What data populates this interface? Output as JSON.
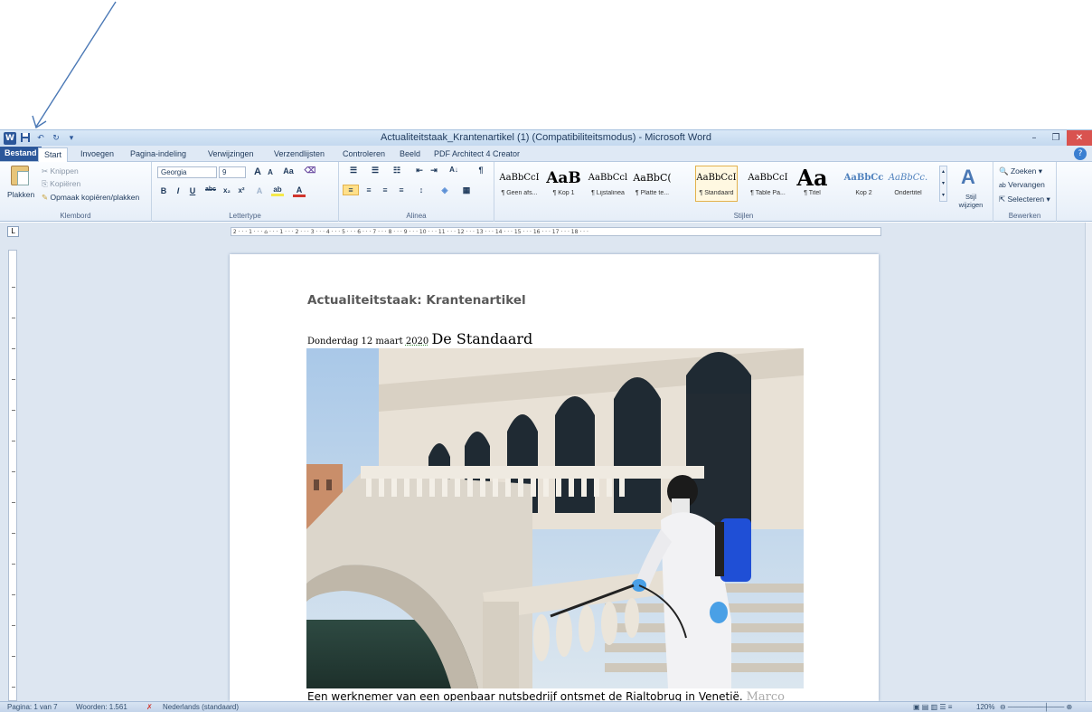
{
  "window": {
    "title": "Actualiteitstaak_Krantenartikel (1) (Compatibiliteitsmodus) - Microsoft Word"
  },
  "tabs": [
    "Bestand",
    "Start",
    "Invoegen",
    "Pagina-indeling",
    "Verwijzingen",
    "Verzendlijsten",
    "Controleren",
    "Beeld",
    "PDF Architect 4 Creator"
  ],
  "ribbon": {
    "clipboard": {
      "paste": "Plakken",
      "cut": "Knippen",
      "copy": "Kopiëren",
      "format_painter": "Opmaak kopiëren/plakken",
      "label": "Klembord"
    },
    "font": {
      "name": "Georgia",
      "size": "9",
      "label": "Lettertype"
    },
    "paragraph": {
      "label": "Alinea"
    },
    "styles": {
      "label": "Stijlen",
      "change": "Stijl wijzigen",
      "items": [
        {
          "sample": "AaBbCcI",
          "name": "¶ Geen afs..."
        },
        {
          "sample": "AaB",
          "name": "¶ Kop 1"
        },
        {
          "sample": "AaBbCcl",
          "name": "¶ Lijstalinea"
        },
        {
          "sample": "AaBbC(",
          "name": "¶ Platte te..."
        },
        {
          "sample": "AaBbCcI",
          "name": "¶ Standaard"
        },
        {
          "sample": "AaBbCcI",
          "name": "¶ Table Pa..."
        },
        {
          "sample": "Aa",
          "name": "¶ Titel"
        },
        {
          "sample": "AaBbCc",
          "name": "Kop 2"
        },
        {
          "sample": "AaBbCc.",
          "name": "Ondertitel"
        }
      ]
    },
    "editing": {
      "find": "Zoeken",
      "replace": "Vervangen",
      "select": "Selecteren",
      "label": "Bewerken"
    }
  },
  "document": {
    "title": "Actualiteitstaak: Krantenartikel",
    "date": "Donderdag 12 maart",
    "year": "2020",
    "newspaper": "De Standaard",
    "caption_before": "Een werknemer van een openbaar nutsbedrijf ontsmet de ",
    "caption_place": "Rialtobrug",
    "caption_after": " in Venetië.",
    "caption_credit": "Marco"
  },
  "statusbar": {
    "page": "Pagina: 1 van 7",
    "words": "Woorden: 1.561",
    "language": "Nederlands (standaard)",
    "zoom": "120%"
  },
  "colors": {
    "accent": "#2b579a",
    "annotation_arrow": "#4a78b5"
  }
}
